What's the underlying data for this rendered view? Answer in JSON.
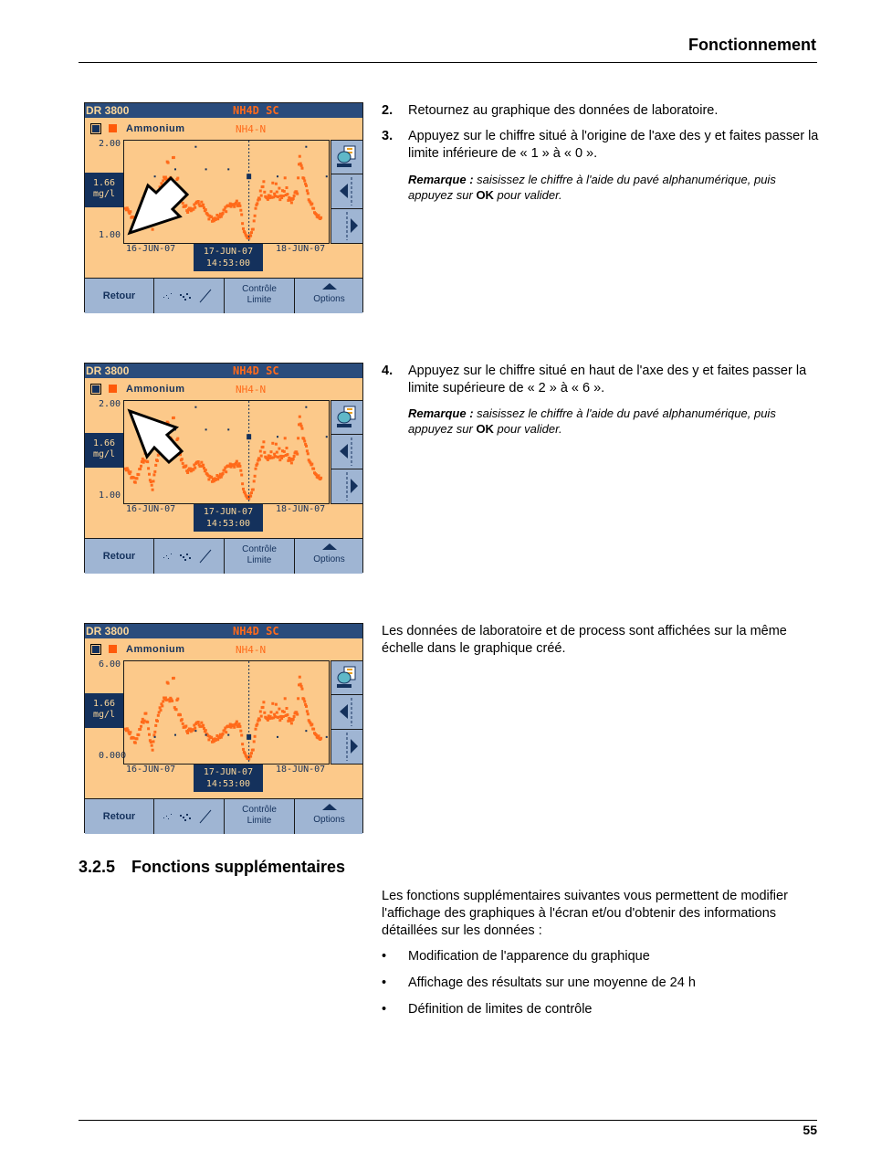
{
  "header": {
    "title": "Fonctionnement"
  },
  "footer": {
    "page_number": "55"
  },
  "colors": {
    "screen_bg": "#fcc98a",
    "screen_navy": "#14315c",
    "title_bar": "#2a4c7c",
    "process_orange": "#ff5a0a",
    "button_blue": "#9fb5d3"
  },
  "screens": [
    {
      "model": "DR 3800",
      "program": "NH4D SC",
      "parameter": "Ammonium",
      "form": "NH4-N",
      "y_top": "2.00",
      "y_bottom": "1.00",
      "cursor_value": "1.66",
      "cursor_unit": "mg/l",
      "dates": [
        "16-JUN-07",
        "17-JUN-07",
        "18-JUN-07"
      ],
      "cursor_date": "17-JUN-07",
      "cursor_time": "14:53:00",
      "buttons": {
        "back": "Retour",
        "control_line1": "Contrôle",
        "control_line2": "Limite",
        "options": "Options"
      },
      "arrow_target": "y-axis-bottom"
    },
    {
      "model": "DR 3800",
      "program": "NH4D SC",
      "parameter": "Ammonium",
      "form": "NH4-N",
      "y_top": "2.00",
      "y_bottom": "1.00",
      "cursor_value": "1.66",
      "cursor_unit": "mg/l",
      "dates": [
        "16-JUN-07",
        "17-JUN-07",
        "18-JUN-07"
      ],
      "cursor_date": "17-JUN-07",
      "cursor_time": "14:53:00",
      "buttons": {
        "back": "Retour",
        "control_line1": "Contrôle",
        "control_line2": "Limite",
        "options": "Options"
      },
      "arrow_target": "y-axis-top"
    },
    {
      "model": "DR 3800",
      "program": "NH4D SC",
      "parameter": "Ammonium",
      "form": "NH4-N",
      "y_top": "6.00",
      "y_bottom": "0.000",
      "cursor_value": "1.66",
      "cursor_unit": "mg/l",
      "dates": [
        "16-JUN-07",
        "17-JUN-07",
        "18-JUN-07"
      ],
      "cursor_date": "17-JUN-07",
      "cursor_time": "14:53:00",
      "buttons": {
        "back": "Retour",
        "control_line1": "Contrôle",
        "control_line2": "Limite",
        "options": "Options"
      },
      "arrow_target": "none"
    }
  ],
  "steps": [
    {
      "num": "2.",
      "text": "Retournez au graphique des données de laboratoire."
    },
    {
      "num": "3.",
      "text": "Appuyez sur le chiffre situé à l'origine de l'axe des y et faites passer la limite inférieure de « 1 » à « 0 »."
    },
    {
      "num": "4.",
      "text": "Appuyez sur le chiffre situé en haut de l'axe des y et faites passer la limite supérieure de « 2 » à « 6 »."
    }
  ],
  "notes": [
    {
      "label": "Remarque :",
      "text1": " saisissez le chiffre à l'aide du pavé alphanumérique, puis appuyez sur ",
      "ok": "OK",
      "text2": " pour valider."
    },
    {
      "label": "Remarque :",
      "text1": " saisissez le chiffre à l'aide du pavé alphanumérique, puis appuyez sur ",
      "ok": "OK",
      "text2": " pour valider."
    }
  ],
  "result_text": "Les données de laboratoire et de process sont affichées sur la même échelle dans le graphique créé.",
  "section": {
    "number": "3.2.5",
    "title": "Fonctions supplémentaires",
    "intro": "Les fonctions supplémentaires suivantes vous permettent de modifier l'affichage des graphiques à l'écran et/ou d'obtenir des informations détaillées sur les données :",
    "bullets": [
      "Modification de l'apparence du graphique",
      "Affichage des résultats sur une moyenne de 24 h",
      "Définition de limites de contrôle"
    ]
  }
}
